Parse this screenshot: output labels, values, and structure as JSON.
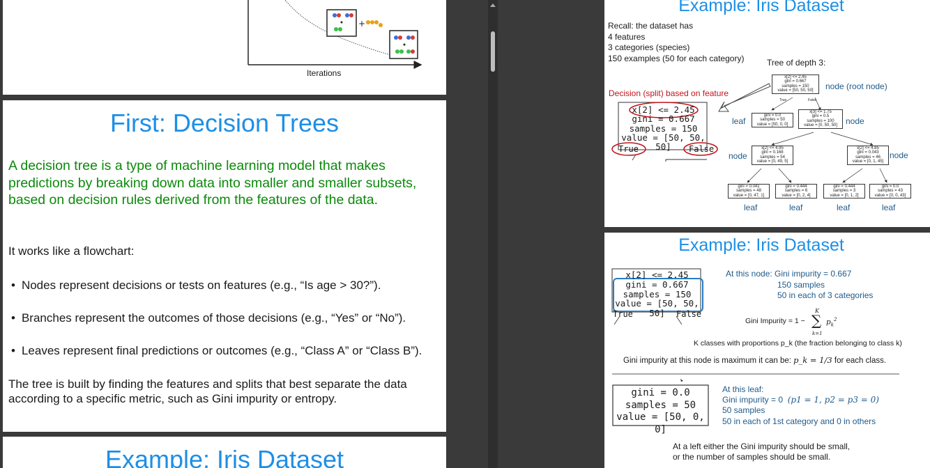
{
  "left": {
    "slide1": {
      "axis_label": "Iterations"
    },
    "slide2": {
      "title": "First: Decision Trees",
      "intro": "A decision tree is a type of machine learning model that makes predictions by breaking down data into smaller and smaller subsets, based on decision rules derived from the features of the data.",
      "flow_lead": "It works like a flowchart:",
      "bullets": [
        "Nodes represent decisions or tests on features (e.g., “Is age > 30?”).",
        "Branches represent the outcomes of those decisions (e.g., “Yes” or “No”).",
        "Leaves represent final predictions or outcomes (e.g., “Class A” or “Class B”)."
      ],
      "closing": "The tree is built by finding the features and splits that best separate the data according to a specific metric, such as Gini impurity or entropy."
    },
    "slide3": {
      "title": "Example: Iris Dataset"
    }
  },
  "right": {
    "slide1": {
      "title": "Example: Iris Dataset",
      "recall": [
        "Recall: the dataset has",
        "4 features",
        "3 categories (species)",
        "150 examples (50 for each category)"
      ],
      "tree_title": "Tree of depth 3:",
      "decision_label": "Decision (split) based on feature",
      "zoom_node": [
        "x[2] <= 2.45",
        "gini = 0.667",
        "samples = 150",
        "value = [50, 50, 50]"
      ],
      "zoom_true": "True",
      "zoom_false": "False",
      "root_label": "node (root node)",
      "leaf_label": "leaf",
      "node_label": "node",
      "tree": {
        "root": [
          "x[2] <= 2.45",
          "gini = 0.667",
          "samples = 150",
          "value = [50, 50, 50]"
        ],
        "root_true": "True",
        "root_false": "False",
        "leaf1": [
          "gini = 0.0",
          "samples = 50",
          "value = [50, 0, 0]"
        ],
        "n1": [
          "x[3] <= 1.75",
          "gini = 0.5",
          "samples = 100",
          "value = [0, 50, 50]"
        ],
        "n2": [
          "x[2] <= 4.95",
          "gini = 0.168",
          "samples = 54",
          "value = [0, 49, 5]"
        ],
        "n3": [
          "x[2] <= 4.85",
          "gini = 0.043",
          "samples = 46",
          "value = [0, 1, 45]"
        ],
        "l1": [
          "gini = 0.041",
          "samples = 48",
          "value = [0, 47, 1]"
        ],
        "l2": [
          "gini = 0.444",
          "samples = 6",
          "value = [0, 2, 4]"
        ],
        "l3": [
          "gini = 0.444",
          "samples = 3",
          "value = [0, 1, 2]"
        ],
        "l4": [
          "gini = 0.0",
          "samples = 43",
          "value = [0, 0, 43]"
        ]
      }
    },
    "slide2": {
      "title": "Example: Iris Dataset",
      "node": [
        "x[2] <= 2.45",
        "gini = 0.667",
        "samples = 150",
        "value = [50, 50, 50]"
      ],
      "true": "True",
      "false": "False",
      "at_node_lead": "At this node: ",
      "at_node": [
        "Gini impurity = 0.667",
        "150 samples",
        "50 in each of 3 categories"
      ],
      "gini_formula_label": "Gini Impurity",
      "classes_note": "K classes with proportions p_k (the fraction belonging to class k)",
      "max_note_pre": "Gini impurity at this node is maximum it can be: ",
      "max_note_formula": "p_k = 1/3",
      "max_note_post": " for each class.",
      "leaf_box": [
        "gini = 0.0",
        "samples = 50",
        "value = [50, 0, 0]"
      ],
      "at_leaf": [
        "At this leaf:",
        "Gini impurity = 0",
        "50 samples",
        "50 in each of 1st category and 0 in others"
      ],
      "at_leaf_formula": "(p1 = 1, p2 = p3 = 0)",
      "footer": [
        "At a left either the Gini impurity should be small,",
        "or the number of samples should be small."
      ]
    }
  }
}
